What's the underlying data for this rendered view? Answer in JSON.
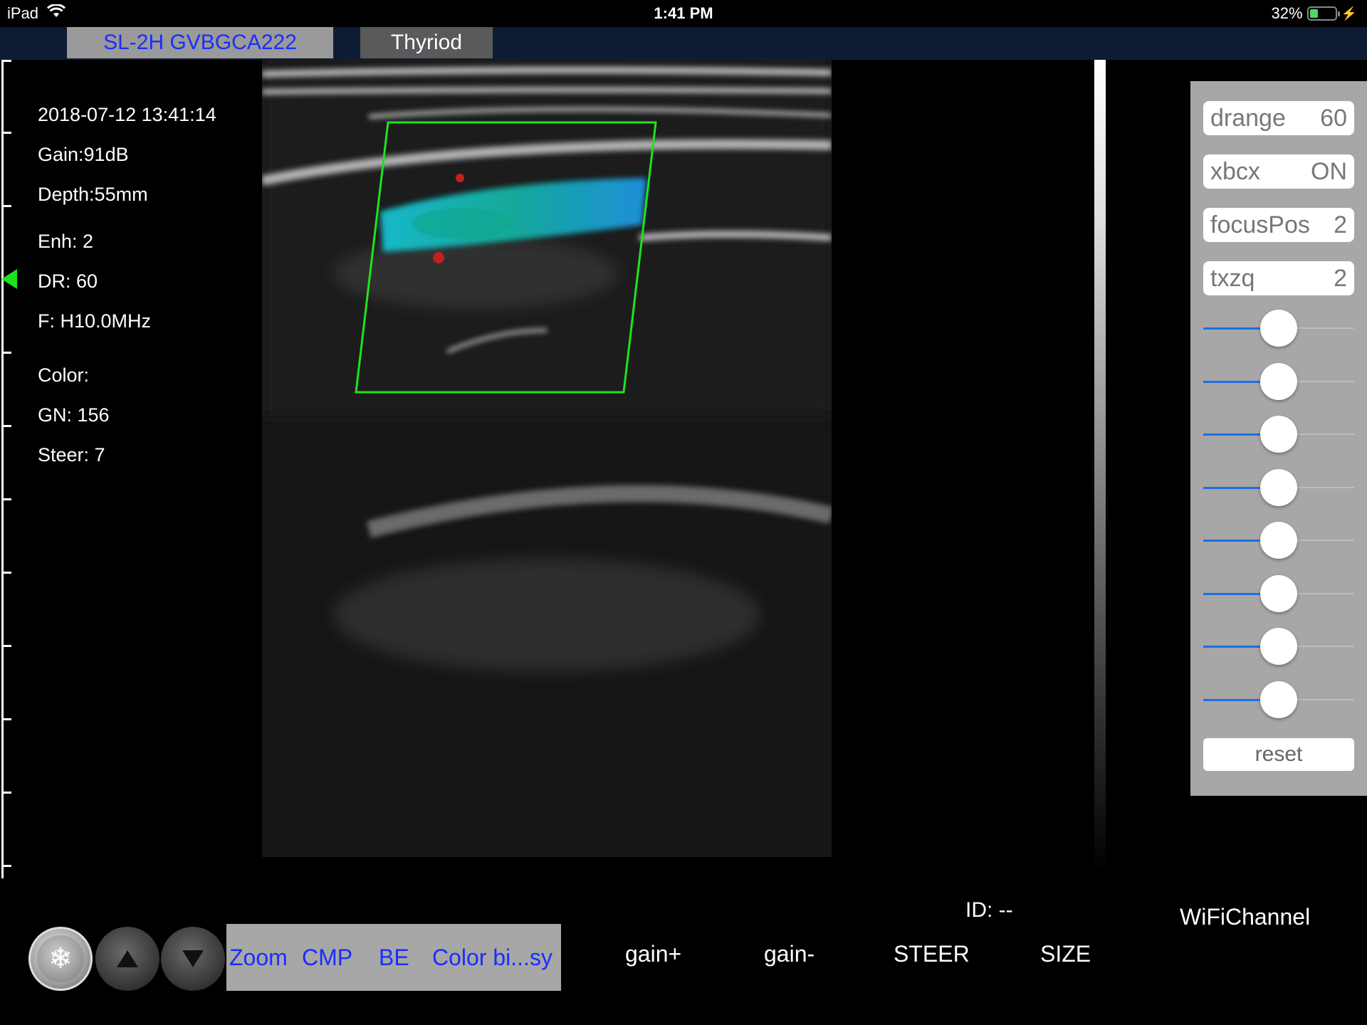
{
  "status_bar": {
    "device": "iPad",
    "time": "1:41 PM",
    "battery_percent": "32%",
    "battery_level": 0.32
  },
  "tabs": {
    "probe": "SL-2H GVBGCA222",
    "preset": "Thyriod"
  },
  "info": {
    "datetime": "2018-07-12 13:41:14",
    "gain": "Gain:91dB",
    "depth": "Depth:55mm",
    "enh": "Enh: 2",
    "dr": "DR: 60",
    "freq": "F: H10.0MHz",
    "color": "Color:",
    "gn": "GN: 156",
    "steer": "Steer: 7"
  },
  "params": [
    {
      "name": "drange",
      "value": "60"
    },
    {
      "name": "xbcx",
      "value": "ON"
    },
    {
      "name": "focusPos",
      "value": "2"
    },
    {
      "name": "txzq",
      "value": "2"
    }
  ],
  "sliders": [
    0.5,
    0.5,
    0.5,
    0.5,
    0.5,
    0.5,
    0.5,
    0.5
  ],
  "reset_label": "reset",
  "id_label": "ID: --",
  "wifi_label": "WiFiChannel",
  "mode_buttons": [
    "Zoom",
    "CMP",
    "BE",
    "Color bi...sy"
  ],
  "bottom_buttons": [
    "gain+",
    "gain-",
    "STEER",
    "SIZE"
  ],
  "icons": {
    "freeze": "snowflake-icon",
    "up": "triangle-up-icon",
    "down": "triangle-down-icon",
    "wifi": "wifi-icon",
    "charging": "bolt-icon"
  },
  "colors": {
    "tab_bar": "#0e1c33",
    "panel": "#a7a7a7",
    "roi_box": "#1fe21f",
    "slider_active": "#1b6fe6",
    "mode_text": "#1a2dff"
  }
}
